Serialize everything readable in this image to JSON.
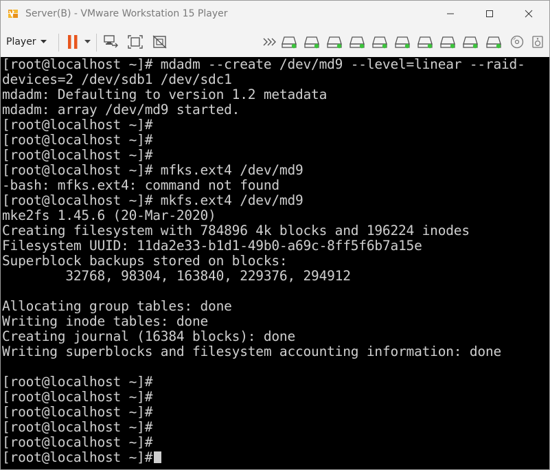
{
  "window": {
    "title": "Server(B) - VMware Workstation 15 Player"
  },
  "toolbar": {
    "player_label": "Player",
    "icons_left": [
      "pause-icon",
      "dropdown-arrow-icon",
      "send-ctrl-alt-del-icon",
      "fit-guest-icon",
      "unity-icon"
    ],
    "icons_right": [
      "more-devices-icon",
      "hdd-device-icon",
      "hdd-device-icon",
      "hdd-device-icon",
      "hdd-device-icon",
      "hdd-device-icon",
      "hdd-device-icon",
      "hdd-device-icon",
      "hdd-device-icon",
      "hdd-device-icon",
      "cd-dvd-icon",
      "sound-icon"
    ],
    "accent_pause": "#e8561e",
    "device_led": "#3cc43c"
  },
  "terminal": {
    "lines": [
      "[root@localhost ~]# mdadm --create /dev/md9 --level=linear --raid-",
      "devices=2 /dev/sdb1 /dev/sdc1",
      "mdadm: Defaulting to version 1.2 metadata",
      "mdadm: array /dev/md9 started.",
      "[root@localhost ~]#",
      "[root@localhost ~]#",
      "[root@localhost ~]#",
      "[root@localhost ~]# mfks.ext4 /dev/md9",
      "-bash: mfks.ext4: command not found",
      "[root@localhost ~]# mkfs.ext4 /dev/md9",
      "mke2fs 1.45.6 (20-Mar-2020)",
      "Creating filesystem with 784896 4k blocks and 196224 inodes",
      "Filesystem UUID: 11da2e33-b1d1-49b0-a69c-8ff5f6b7a15e",
      "Superblock backups stored on blocks:",
      "        32768, 98304, 163840, 229376, 294912",
      "",
      "Allocating group tables: done",
      "Writing inode tables: done",
      "Creating journal (16384 blocks): done",
      "Writing superblocks and filesystem accounting information: done",
      "",
      "[root@localhost ~]#",
      "[root@localhost ~]#",
      "[root@localhost ~]#",
      "[root@localhost ~]#",
      "[root@localhost ~]#",
      "[root@localhost ~]#"
    ]
  }
}
